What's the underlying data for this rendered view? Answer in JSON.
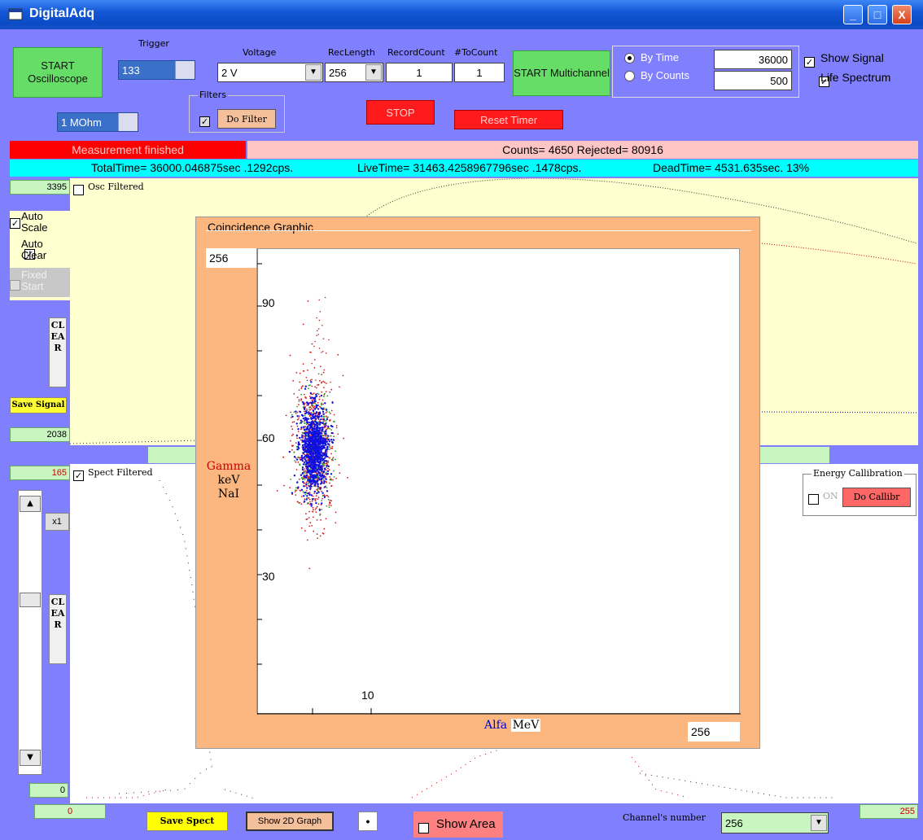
{
  "window": {
    "title": "DigitalAdq",
    "minimize": "_",
    "maximize": "□",
    "close": "X"
  },
  "controls": {
    "start_osc": "START Oscilloscope",
    "trigger_label": "Trigger",
    "trigger_value": "133",
    "impedance": "1 MOhm",
    "voltage_label": "Voltage",
    "voltage_value": "2 V",
    "reclength_label": "RecLength",
    "reclength_value": "256",
    "recordcount_label": "RecordCount",
    "recordcount_value": "1",
    "tocount_label": "#ToCount",
    "tocount_value": "1",
    "filters_label": "Filters",
    "do_filter": "Do Filter",
    "stop": "STOP",
    "reset_timer": "Reset Timer",
    "start_multi": "START Multichannel",
    "by_time": "By Time",
    "by_counts": "By Counts",
    "time_value": "36000",
    "counts_value": "500",
    "show_signal": "Show Signal",
    "life_spectrum": "Life Spectrum"
  },
  "status": {
    "measurement": "Measurement finished",
    "counts": "Counts= 4650 Rejected= 80916",
    "total_time": "TotalTime= 36000.046875sec .1292cps.",
    "live_time": "LiveTime= 31463.4258967796sec .1478cps.",
    "dead_time": "DeadTime= 4531.635sec. 13%"
  },
  "osc": {
    "ymax": "3395",
    "ymin": "2038",
    "filtered_label": "Osc Filtered",
    "auto_scale": "Auto Scale",
    "auto_clear": "Auto Clear",
    "fixed_start": "Fixed Start",
    "clear": "CLEAR",
    "save_signal": "Save Signal"
  },
  "spect": {
    "ymax": "165",
    "ymin": "0",
    "xmin": "0",
    "xmax": "255",
    "filtered_label": "Spect Filtered",
    "zoom": "x1",
    "clear": "CLEAR",
    "save_spect": "Save Spect",
    "show_2d": "Show 2D Graph",
    "dot": "•",
    "show_area": "Show Area",
    "channels_label": "Channel's number",
    "channels_value": "256"
  },
  "energy": {
    "label": "Energy Callibration",
    "on": "ON",
    "do_callibr": "Do Callibr"
  },
  "coincidence": {
    "title": "Coincidence Graphic",
    "y_max": "256",
    "x_max": "256",
    "y_ticks": [
      "90",
      "60",
      "30"
    ],
    "x_tick": "10",
    "y_label_1": "Gamma",
    "y_label_2": "keV",
    "y_label_3": "NaI",
    "x_label_1": "Alfa",
    "x_label_2": "MeV"
  },
  "colors": {
    "bg": "#8080ff",
    "panel": "#f8b482",
    "plot_bg": "#ffffd0",
    "status_red": "#ff0000",
    "status_pink": "#ffc4c4",
    "status_cyan": "#00ffff"
  }
}
